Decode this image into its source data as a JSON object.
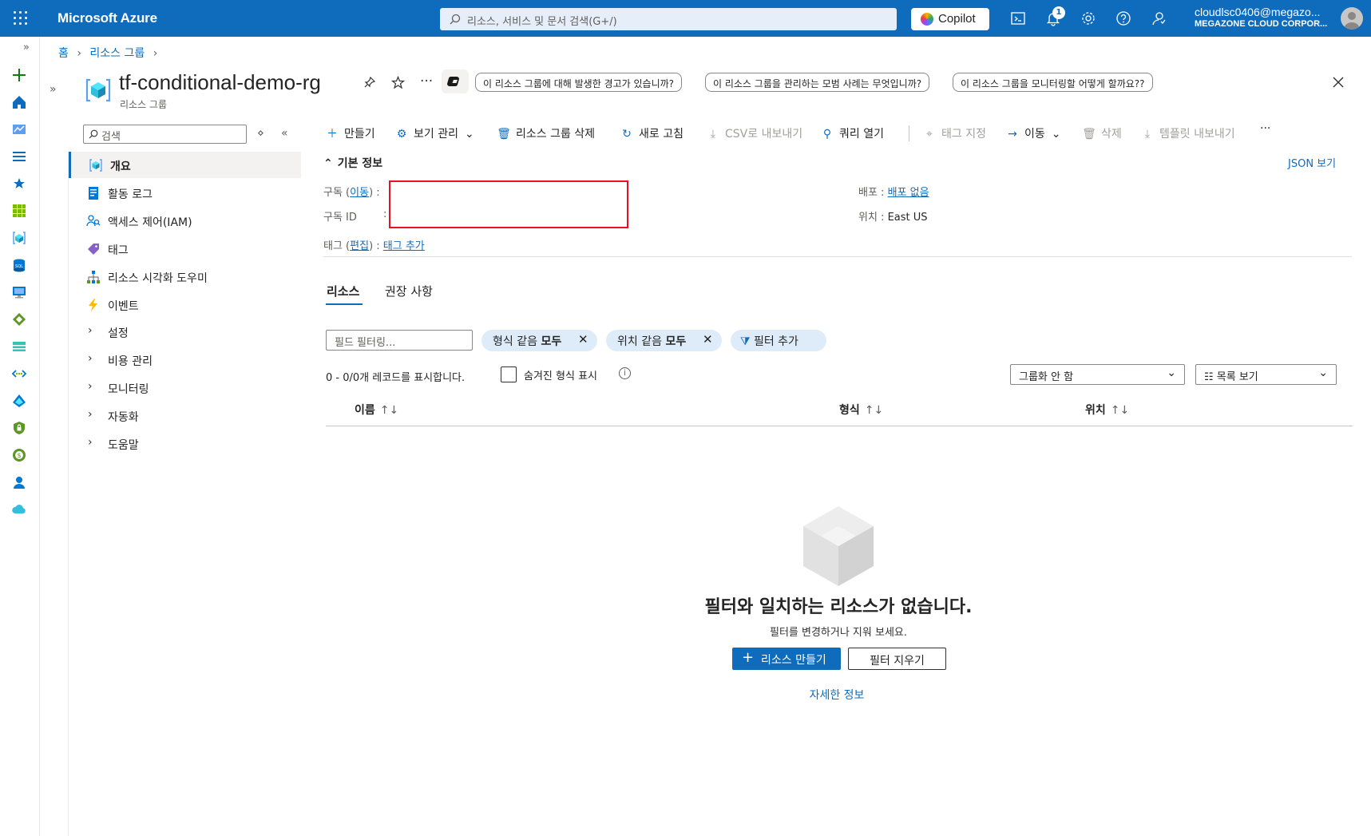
{
  "topbar": {
    "brand": "Microsoft Azure",
    "search_placeholder": "리소스, 서비스 및 문서 검색(G+/)",
    "copilot_label": "Copilot",
    "notification_count": "1",
    "user_email": "cloudlsc0406@megazo...",
    "user_org": "MEGAZONE CLOUD CORPOR..."
  },
  "breadcrumb": {
    "home": "홈",
    "resource_groups": "리소스 그룹"
  },
  "header": {
    "title": "tf-conditional-demo-rg",
    "subtitle": "리소스 그룹",
    "prompts": [
      "이 리소스 그룹에 대해 발생한 경고가 있습니까?",
      "이 리소스 그룹을 관리하는 모범 사례는 무엇입니까?",
      "이 리소스 그룹을 모니터링할 어떻게 할까요??"
    ]
  },
  "menu": {
    "search_placeholder": "검색",
    "items": [
      {
        "label": "개요",
        "icon": "resource-group-icon"
      },
      {
        "label": "활동 로그",
        "icon": "activity-log-icon"
      },
      {
        "label": "액세스 제어(IAM)",
        "icon": "iam-icon"
      },
      {
        "label": "태그",
        "icon": "tag-icon"
      },
      {
        "label": "리소스 시각화 도우미",
        "icon": "visualizer-icon"
      },
      {
        "label": "이벤트",
        "icon": "lightning-icon"
      }
    ],
    "groups": [
      "설정",
      "비용 관리",
      "모니터링",
      "자동화",
      "도움말"
    ]
  },
  "commands": {
    "create": "만들기",
    "manage_view": "보기 관리",
    "delete_rg": "리소스 그룹 삭제",
    "refresh": "새로 고침",
    "export_csv": "CSV로 내보내기",
    "open_query": "쿼리 열기",
    "assign_tags": "태그 지정",
    "move": "이동",
    "delete": "삭제",
    "export_template": "템플릿 내보내기"
  },
  "essentials": {
    "header": "기본 정보",
    "json_view": "JSON 보기",
    "subscription_label": "구독",
    "subscription_link": "이동",
    "subscription_id_label": "구독 ID",
    "tags_label": "태그",
    "tags_edit_link": "편집",
    "tags_add_link": "태그 추가",
    "deployments_label": "배포",
    "deployments_value": "배포 없음",
    "location_label": "위치",
    "location_value": "East US"
  },
  "tabs": {
    "resources": "리소스",
    "recommendations": "권장 사항"
  },
  "filters": {
    "field_filter_placeholder": "필드 필터링...",
    "type_pill_prefix": "형식 같음",
    "type_pill_value": "모두",
    "location_pill_prefix": "위치 같음",
    "location_pill_value": "모두",
    "add_filter": "필터 추가",
    "records": "0 - 0/0개 레코드를 표시합니다.",
    "show_hidden_types": "숨겨진 형식 표시",
    "grouping": "그룹화 안 함",
    "view_mode": "목록 보기"
  },
  "table": {
    "columns": [
      "이름",
      "형식",
      "위치"
    ]
  },
  "empty_state": {
    "title": "필터와 일치하는 리소스가 없습니다.",
    "subtitle": "필터를 변경하거나 지워 보세요.",
    "create_button": "리소스 만들기",
    "clear_button": "필터 지우기",
    "more_info": "자세한 정보"
  }
}
